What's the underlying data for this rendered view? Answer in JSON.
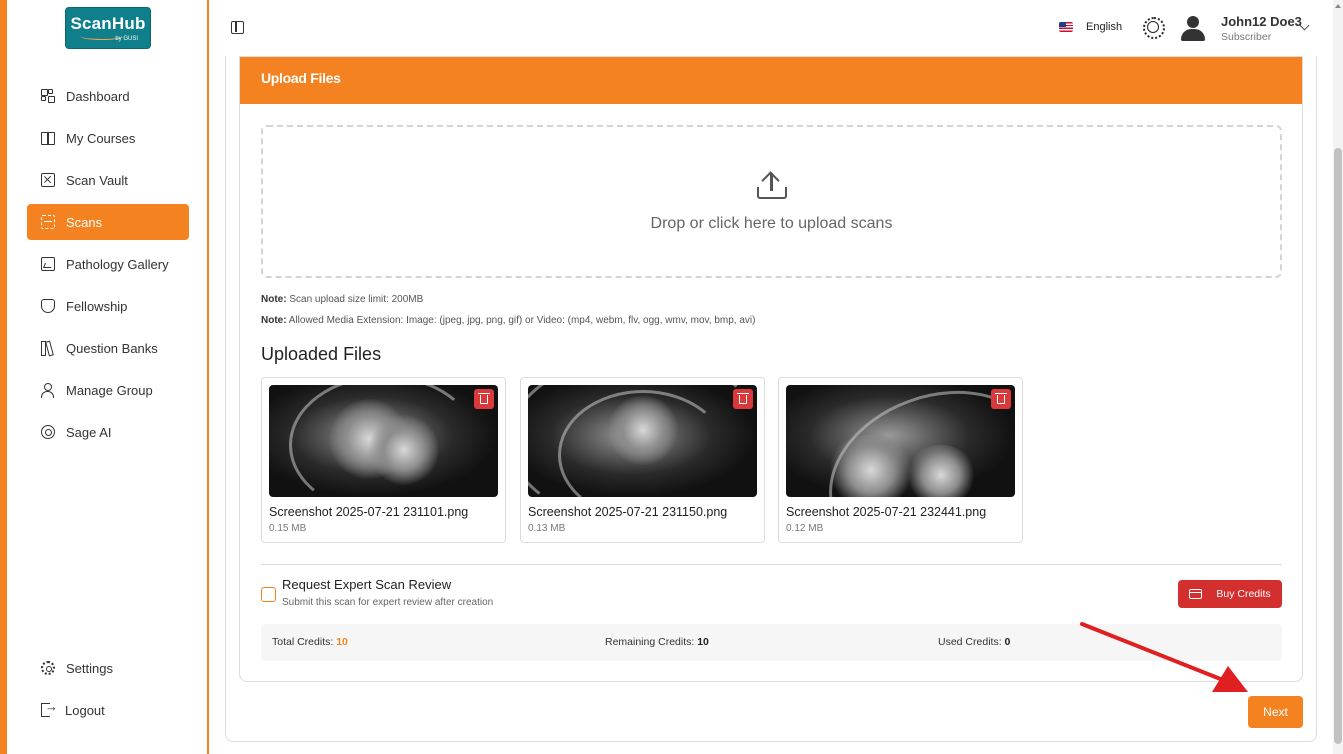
{
  "brand": {
    "logo_main": "ScanHub",
    "logo_sub": "by GUSI",
    "accent_color": "#f58220",
    "logo_color": "#0f7f8c"
  },
  "sidebar": {
    "items": [
      {
        "label": "Dashboard",
        "icon": "grid-icon"
      },
      {
        "label": "My Courses",
        "icon": "book-icon"
      },
      {
        "label": "Scan Vault",
        "icon": "vault-icon"
      },
      {
        "label": "Scans",
        "icon": "scan-icon",
        "active": true
      },
      {
        "label": "Pathology Gallery",
        "icon": "gallery-icon"
      },
      {
        "label": "Fellowship",
        "icon": "shield-icon"
      },
      {
        "label": "Question Banks",
        "icon": "books-icon"
      },
      {
        "label": "Manage Group",
        "icon": "users-icon"
      },
      {
        "label": "Sage AI",
        "icon": "ai-icon"
      }
    ],
    "bottom_items": [
      {
        "label": "Settings",
        "icon": "gear-icon"
      },
      {
        "label": "Logout",
        "icon": "logout-icon"
      }
    ]
  },
  "topbar": {
    "language": "English",
    "user_name": "John12 Doe3",
    "user_role": "Subscriber"
  },
  "upload": {
    "title": "Upload Files",
    "drop_text": "Drop or click here to upload scans",
    "note_label": "Note:",
    "note1": " Scan upload size limit: 200MB",
    "note2": " Allowed Media Extension: Image: (jpeg, jpg, png, gif) or Video: (mp4, webm, flv, ogg, wmv, mov, bmp, avi)"
  },
  "uploaded": {
    "title": "Uploaded Files",
    "files": [
      {
        "name": "Screenshot 2025-07-21 231101.png",
        "size": "0.15 MB"
      },
      {
        "name": "Screenshot 2025-07-21 231150.png",
        "size": "0.13 MB"
      },
      {
        "name": "Screenshot 2025-07-21 232441.png",
        "size": "0.12 MB"
      }
    ]
  },
  "review": {
    "title": "Request Expert Scan Review",
    "subtitle": "Submit this scan for expert review after creation",
    "buy_label": "Buy Credits"
  },
  "credits": {
    "total_label": "Total Credits:",
    "total_value": "10",
    "remaining_label": "Remaining Credits:",
    "remaining_value": "10",
    "used_label": "Used Credits:",
    "used_value": "0"
  },
  "actions": {
    "next_label": "Next"
  },
  "annotation": {
    "arrow_color": "#e02020"
  }
}
